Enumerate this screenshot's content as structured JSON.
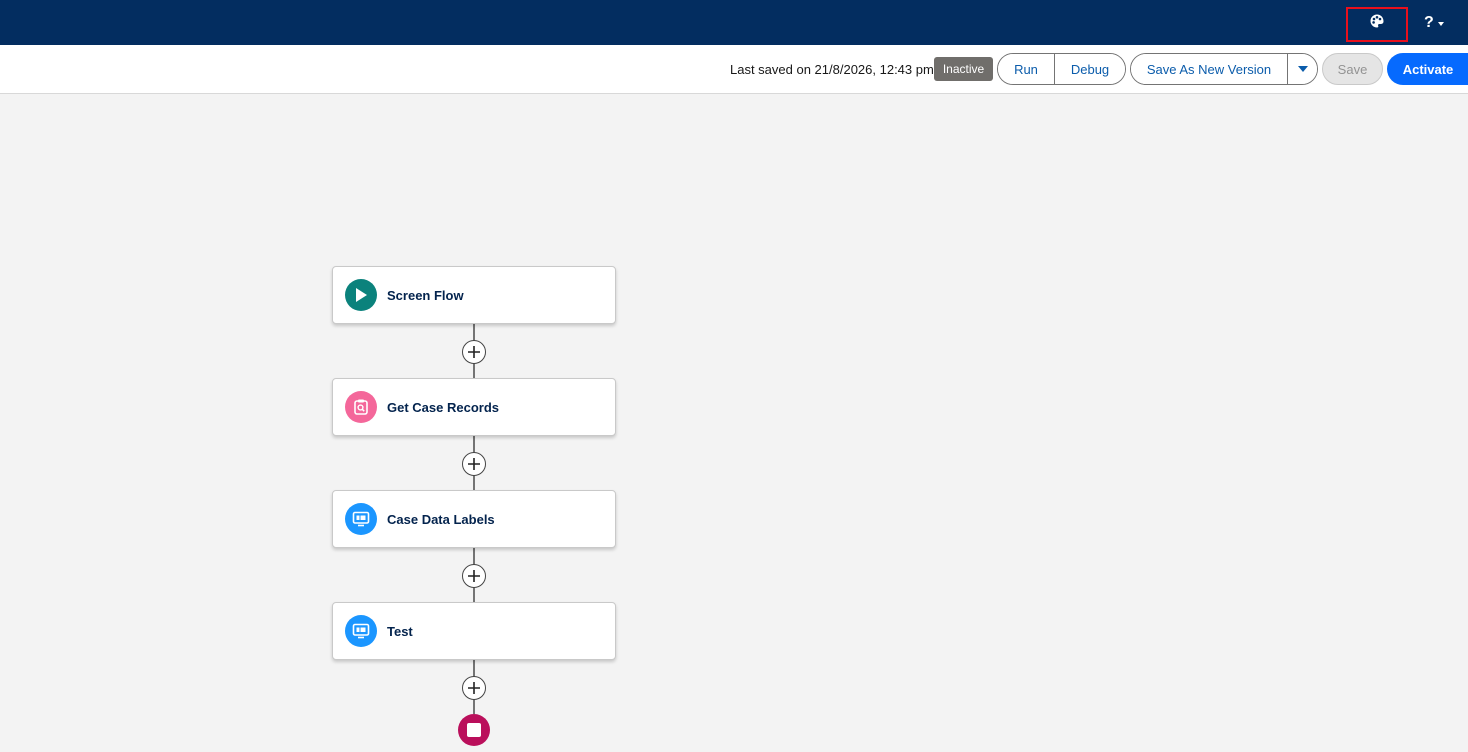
{
  "header": {
    "palette_icon": "palette-icon",
    "help_label": "?"
  },
  "toolbar": {
    "last_saved": "Last saved on 21/8/2026, 12:43 pm",
    "status_badge": "Inactive",
    "run_label": "Run",
    "debug_label": "Debug",
    "save_as_new_version_label": "Save As New Version",
    "save_label": "Save",
    "activate_label": "Activate"
  },
  "flow": {
    "nodes": [
      {
        "label": "Screen Flow",
        "type": "start",
        "icon": "play-icon",
        "color": "#0b827c"
      },
      {
        "label": "Get Case Records",
        "type": "get-records",
        "icon": "record-lookup-icon",
        "color": "#f4679a"
      },
      {
        "label": "Case Data Labels",
        "type": "screen",
        "icon": "screen-icon",
        "color": "#1b96ff"
      },
      {
        "label": "Test",
        "type": "screen",
        "icon": "screen-icon",
        "color": "#1b96ff"
      }
    ],
    "end_color": "#ba0f5b"
  },
  "colors": {
    "header_bg": "#032d60",
    "brand_blue": "#066afe",
    "canvas_bg": "#f3f3f3"
  }
}
